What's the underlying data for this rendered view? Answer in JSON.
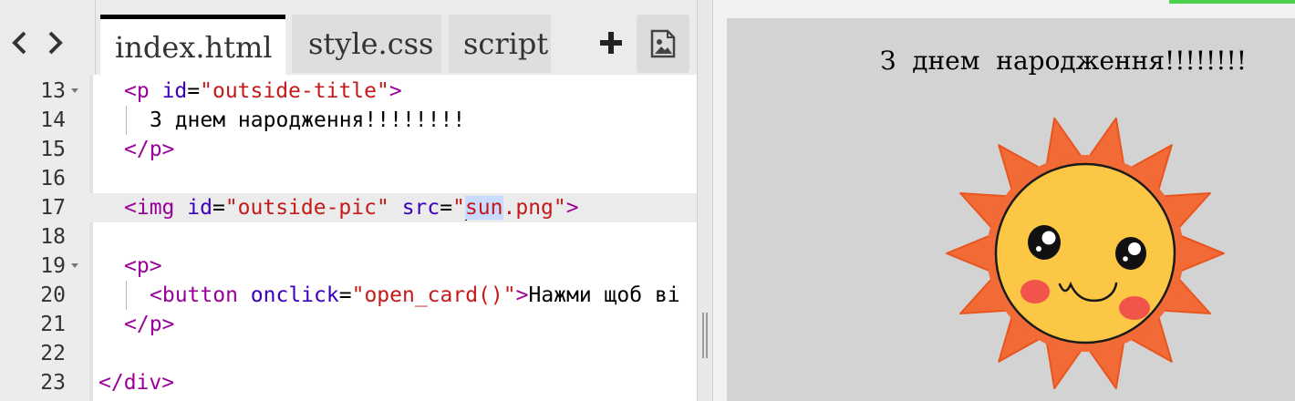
{
  "editor": {
    "tabs": [
      {
        "label": "index.html",
        "active": true
      },
      {
        "label": "style.css",
        "active": false
      },
      {
        "label": "script.",
        "active": false
      }
    ],
    "nav_icons": [
      "chevron-left-icon",
      "chevron-right-icon"
    ],
    "toolbar_icons": [
      "plus-icon",
      "image-icon"
    ],
    "lines": [
      {
        "n": "13",
        "fold": true
      },
      {
        "n": "14",
        "fold": false
      },
      {
        "n": "15",
        "fold": false
      },
      {
        "n": "16",
        "fold": false
      },
      {
        "n": "17",
        "fold": false,
        "current": true
      },
      {
        "n": "18",
        "fold": false
      },
      {
        "n": "19",
        "fold": true
      },
      {
        "n": "20",
        "fold": false
      },
      {
        "n": "21",
        "fold": false
      },
      {
        "n": "22",
        "fold": false
      },
      {
        "n": "23",
        "fold": false
      }
    ],
    "code": {
      "l13": {
        "open": "<p",
        "attr": "id",
        "eq": "=",
        "val": "\"outside-title\"",
        "close": ">"
      },
      "l14": {
        "text": "З днем народження!!!!!!!!"
      },
      "l15": {
        "tag": "</p>"
      },
      "l17": {
        "open": "<img",
        "attr1": "id",
        "eq": "=",
        "val1": "\"outside-pic\"",
        "attr2": "src",
        "q": "\"",
        "selected": "sun",
        "rest": ".png\"",
        "close": ">"
      },
      "l19": {
        "tag": "<p>"
      },
      "l20": {
        "open": "<button",
        "attr": "onclick",
        "eq": "=",
        "val": "\"open_card()\"",
        "close": ">",
        "text": "Нажми щоб ві"
      },
      "l21": {
        "tag": "</p>"
      },
      "l23": {
        "tag": "</div>"
      }
    }
  },
  "preview": {
    "title": "З  днем  народження!!!!!!!!",
    "image_alt": "sun"
  },
  "colors": {
    "tag": "#990099",
    "attribute": "#3a00bb",
    "string": "#c41a1a",
    "sun_ray": "#f26a35",
    "sun_face": "#fbc744",
    "cheek": "#f0544a"
  }
}
